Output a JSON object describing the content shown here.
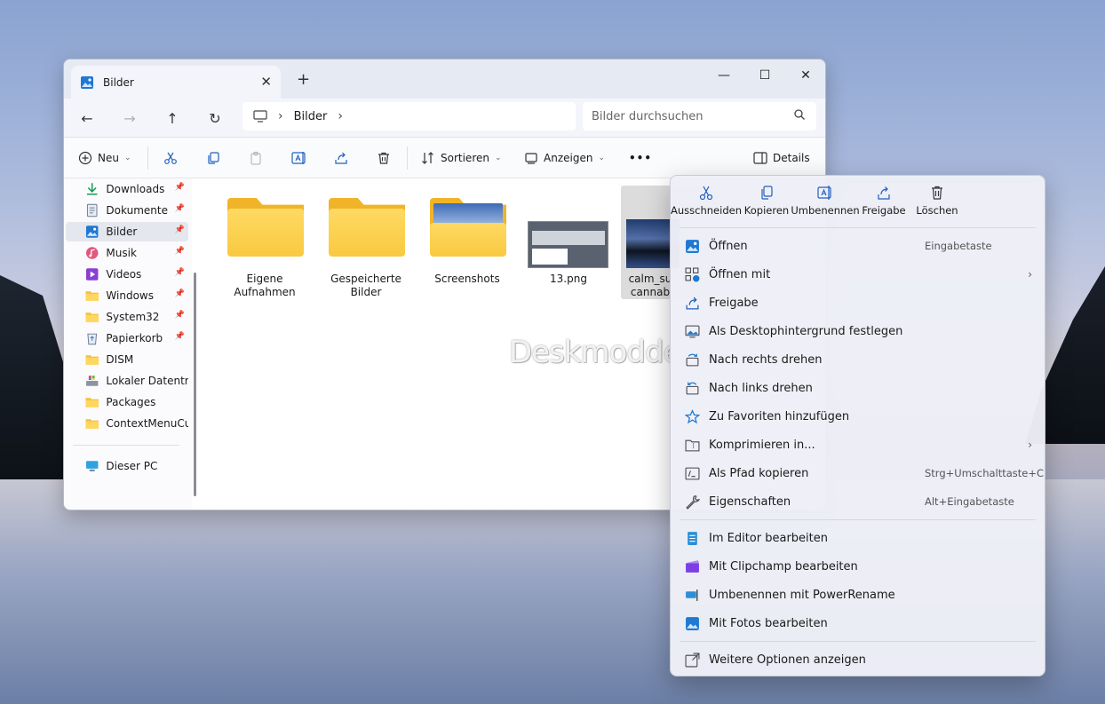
{
  "window": {
    "tab_title": "Bilder",
    "new_tab": "+",
    "controls": {
      "minimize": "—",
      "maximize": "☐",
      "close": "✕"
    }
  },
  "nav": {
    "address": [
      "Bilder"
    ],
    "search_placeholder": "Bilder durchsuchen"
  },
  "toolbar": {
    "new_label": "Neu",
    "sort_label": "Sortieren",
    "view_label": "Anzeigen",
    "more_label": "•••",
    "details_label": "Details"
  },
  "sidebar": {
    "items": [
      {
        "label": "Downloads",
        "pinned": true
      },
      {
        "label": "Dokumente",
        "pinned": true
      },
      {
        "label": "Bilder",
        "pinned": true,
        "selected": true
      },
      {
        "label": "Musik",
        "pinned": true
      },
      {
        "label": "Videos",
        "pinned": true
      },
      {
        "label": "Windows",
        "pinned": true
      },
      {
        "label": "System32",
        "pinned": true
      },
      {
        "label": "Papierkorb",
        "pinned": true
      },
      {
        "label": "DISM",
        "pinned": false
      },
      {
        "label": "Lokaler Datenträg",
        "pinned": false
      },
      {
        "label": "Packages",
        "pinned": false
      },
      {
        "label": "ContextMenuCus",
        "pinned": false
      }
    ],
    "this_pc": "Dieser PC"
  },
  "files": [
    {
      "label": "Eigene Aufnahmen",
      "type": "folder"
    },
    {
      "label": "Gespeicherte Bilder",
      "type": "folder"
    },
    {
      "label": "Screenshots",
      "type": "folder-image"
    },
    {
      "label": "13.png",
      "type": "image"
    },
    {
      "label": "calm_su cannab",
      "type": "image",
      "selected": true
    }
  ],
  "watermark": "Deskmodder.de",
  "context_menu": {
    "quick_actions": [
      "Ausschneiden",
      "Kopieren",
      "Umbenennen",
      "Freigabe",
      "Löschen"
    ],
    "items": [
      {
        "label": "Öffnen",
        "shortcut": "Eingabetaste",
        "icon": "photos-icon"
      },
      {
        "label": "Öffnen mit",
        "submenu": true,
        "icon": "open-with-icon"
      },
      {
        "label": "Freigabe",
        "icon": "share-icon"
      },
      {
        "label": "Als Desktophintergrund festlegen",
        "icon": "wallpaper-icon"
      },
      {
        "label": "Nach rechts drehen",
        "icon": "rotate-right-icon"
      },
      {
        "label": "Nach links drehen",
        "icon": "rotate-left-icon"
      },
      {
        "label": "Zu Favoriten hinzufügen",
        "icon": "star-icon"
      },
      {
        "label": "Komprimieren in...",
        "submenu": true,
        "icon": "zip-icon"
      },
      {
        "label": "Als Pfad kopieren",
        "shortcut": "Strg+Umschalttaste+C",
        "icon": "copy-path-icon"
      },
      {
        "label": "Eigenschaften",
        "shortcut": "Alt+Eingabetaste",
        "icon": "wrench-icon"
      }
    ],
    "apps": [
      {
        "label": "Im Editor bearbeiten",
        "icon": "notepad-icon"
      },
      {
        "label": "Mit Clipchamp bearbeiten",
        "icon": "clipchamp-icon"
      },
      {
        "label": "Umbenennen mit PowerRename",
        "icon": "powerrename-icon"
      },
      {
        "label": "Mit Fotos bearbeiten",
        "icon": "photos-edit-icon"
      }
    ],
    "more": "Weitere Optionen anzeigen"
  }
}
